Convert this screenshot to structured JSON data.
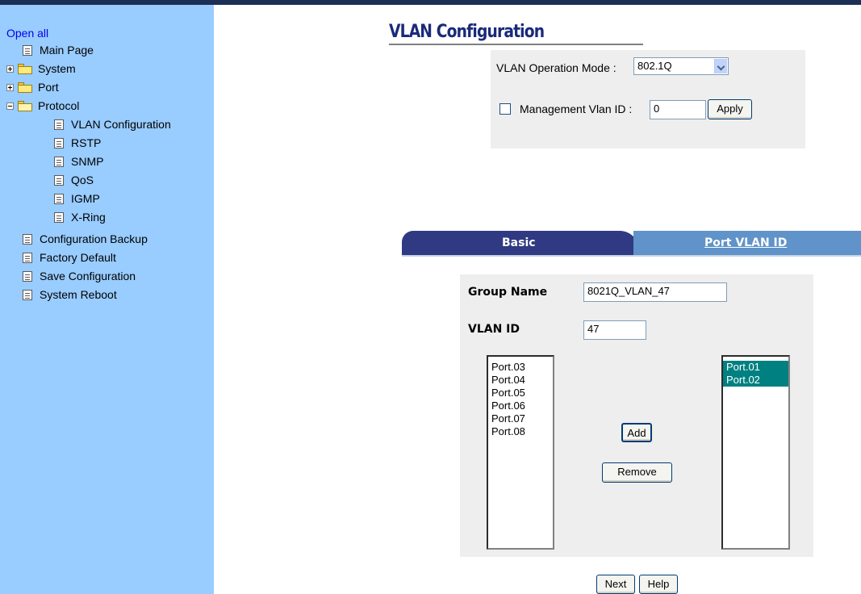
{
  "sidebar": {
    "open_all": "Open all",
    "items": [
      {
        "label": "Main Page"
      },
      {
        "label": "System"
      },
      {
        "label": "Port"
      },
      {
        "label": "Protocol"
      },
      {
        "label": "VLAN Configuration"
      },
      {
        "label": "RSTP"
      },
      {
        "label": "SNMP"
      },
      {
        "label": "QoS"
      },
      {
        "label": "IGMP"
      },
      {
        "label": "X-Ring"
      },
      {
        "label": "Configuration Backup"
      },
      {
        "label": "Factory Default"
      },
      {
        "label": "Save Configuration"
      },
      {
        "label": "System Reboot"
      }
    ]
  },
  "page": {
    "title": "VLAN Configuration"
  },
  "mode_panel": {
    "mode_label": "VLAN Operation Mode :",
    "mode_value": "802.1Q",
    "mgmt_label": "Management Vlan ID :",
    "mgmt_value": "0",
    "mgmt_checked": false,
    "apply": "Apply"
  },
  "tabs": {
    "basic": "Basic",
    "port_vlan_id": "Port VLAN ID"
  },
  "group": {
    "group_name_label": "Group Name",
    "group_name_value": "8021Q_VLAN_47",
    "vlan_id_label": "VLAN ID",
    "vlan_id_value": "47",
    "available_ports": [
      "Port.03",
      "Port.04",
      "Port.05",
      "Port.06",
      "Port.07",
      "Port.08"
    ],
    "member_ports": [
      "Port.01",
      "Port.02"
    ],
    "add": "Add",
    "remove": "Remove"
  },
  "footer": {
    "next": "Next",
    "help": "Help"
  },
  "colors": {
    "sidebar_bg": "#99ccff",
    "tab_active": "#2f3a82",
    "tab_inactive": "#5f93c9",
    "selection": "#008080"
  }
}
